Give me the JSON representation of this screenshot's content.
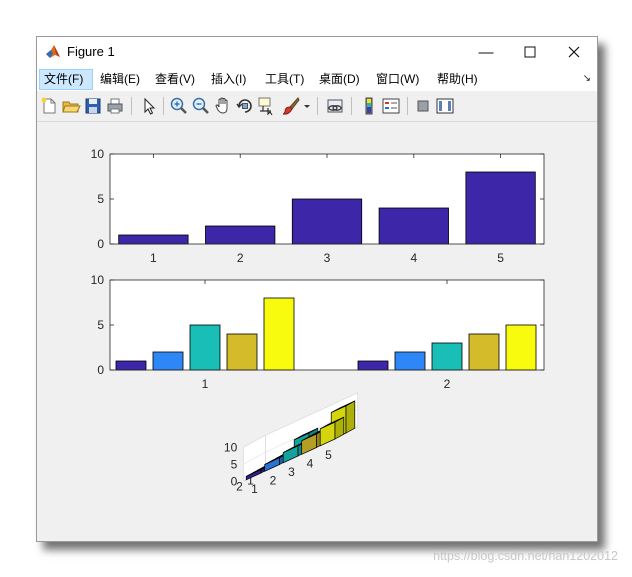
{
  "window": {
    "title": "Figure 1",
    "minimize_label": "—",
    "maximize_label": "☐",
    "close_label": "✕"
  },
  "menu": {
    "items": [
      {
        "label": "文件(F)",
        "active": true
      },
      {
        "label": "编辑(E)"
      },
      {
        "label": "查看(V)"
      },
      {
        "label": "插入(I)"
      },
      {
        "label": "工具(T)"
      },
      {
        "label": "桌面(D)"
      },
      {
        "label": "窗口(W)"
      },
      {
        "label": "帮助(H)"
      }
    ],
    "overflow_icon": "↘"
  },
  "toolbar": {
    "icons": [
      "new-figure-icon",
      "open-file-icon",
      "save-icon",
      "print-icon",
      "select-arrow-icon",
      "zoom-in-icon",
      "zoom-out-icon",
      "pan-hand-icon",
      "rotate-3d-icon",
      "data-cursor-icon",
      "brush-icon",
      "brush-dropdown-icon",
      "link-plot-icon",
      "colorbar-icon",
      "legend-icon",
      "hide-plot-tools-icon",
      "show-plot-tools-icon"
    ]
  },
  "colors": {
    "series": [
      "#3e26a8",
      "#2e87f7",
      "#19bfb7",
      "#d4bb2a",
      "#f9fb0e"
    ]
  },
  "watermark": "https://blog.csdn.net/han1202012",
  "chart_data": [
    {
      "type": "bar",
      "categories": [
        "1",
        "2",
        "3",
        "4",
        "5"
      ],
      "values": [
        1,
        2,
        5,
        4,
        8
      ],
      "ylim": [
        0,
        10
      ],
      "yticks": [
        "0",
        "5",
        "10"
      ]
    },
    {
      "type": "bar",
      "categories": [
        "1",
        "2"
      ],
      "series": [
        {
          "values": [
            1,
            1
          ]
        },
        {
          "values": [
            2,
            2
          ]
        },
        {
          "values": [
            5,
            3
          ]
        },
        {
          "values": [
            4,
            4
          ]
        },
        {
          "values": [
            8,
            5
          ]
        }
      ],
      "ylim": [
        0,
        10
      ],
      "yticks": [
        "0",
        "5",
        "10"
      ]
    },
    {
      "type": "bar3",
      "rows": [
        "1",
        "2"
      ],
      "columns": [
        "1",
        "2",
        "3",
        "4",
        "5"
      ],
      "values": [
        [
          1,
          2,
          5,
          4,
          8
        ],
        [
          1,
          2,
          3,
          4,
          5
        ]
      ],
      "zticks": [
        "0",
        "5",
        "10"
      ]
    }
  ]
}
